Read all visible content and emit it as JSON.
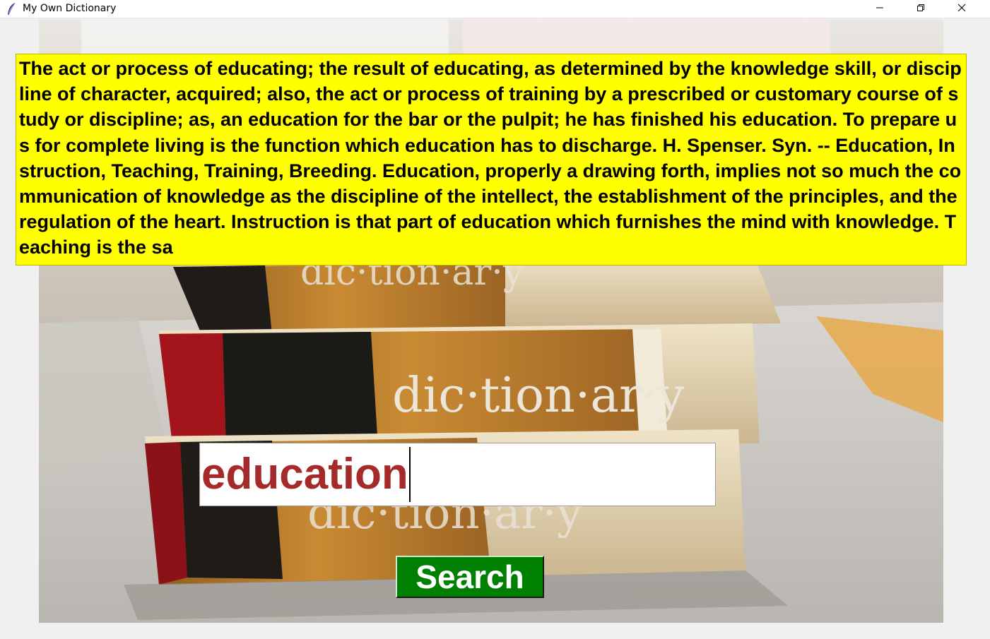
{
  "window": {
    "title": "My Own Dictionary",
    "icon": "feather-icon",
    "controls": [
      "minimize-icon",
      "maximize-icon",
      "close-icon"
    ]
  },
  "background": {
    "book_spine_text_top": "dic·tion·ar·y",
    "book_spine_text_middle": "dic·tion·ar·y",
    "book_spine_text_bottom": "dic·tion·ar·y"
  },
  "definition": {
    "text": "The act or process of educating; the result of educating, as determined by the knowledge skill, or discipline of character, acquired; also, the act or process of training by a prescribed or customary course of study or discipline; as, an education for the bar or the pulpit; he has finished his education. To prepare us for complete living is the function which education has to discharge. H. Spenser. Syn. -- Education, Instruction, Teaching, Training, Breeding. Education, properly a drawing forth, implies not so much the communication of knowledge as the discipline of the intellect, the establishment of the principles, and the regulation of the heart. Instruction is that part of education which furnishes the mind with knowledge. Teaching is the sa",
    "background_color": "#ffff00"
  },
  "search": {
    "input_value": "education",
    "input_text_color": "#a52a2a",
    "button_label": "Search",
    "button_color": "#008000"
  }
}
